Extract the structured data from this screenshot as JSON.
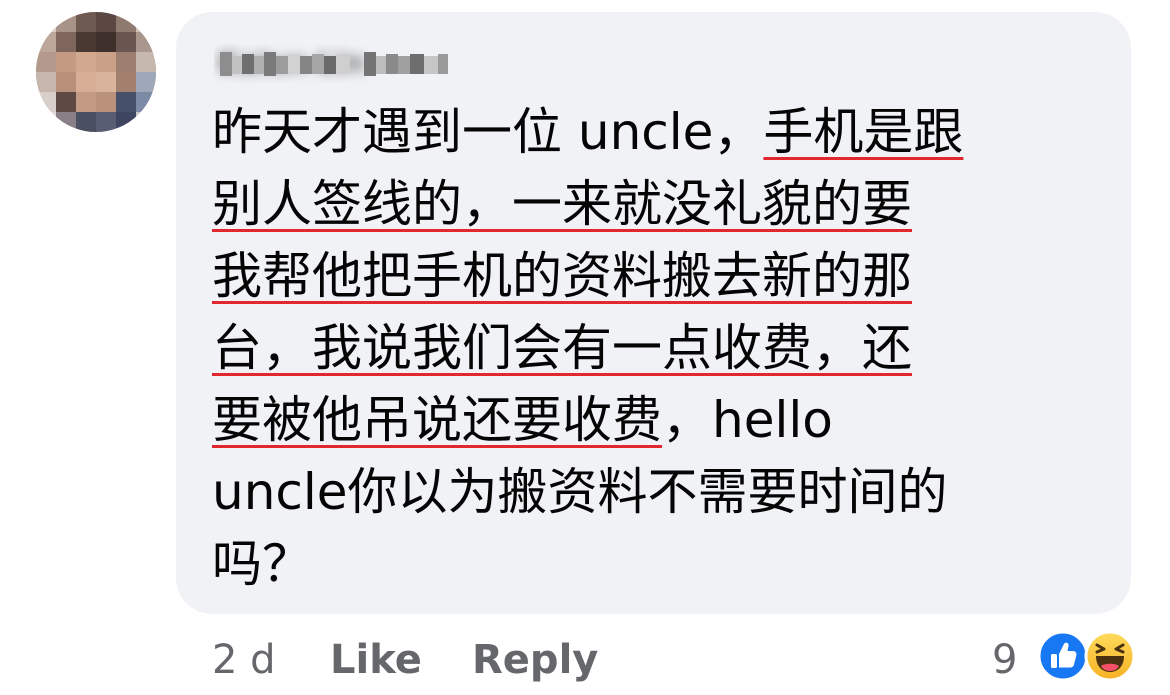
{
  "comment": {
    "author_name": "Kaiun Lin",
    "lines": [
      {
        "plain_before": "昨天才遇到一位 uncle，",
        "underlined": "手机是跟",
        "plain_after": ""
      },
      {
        "plain_before": "",
        "underlined": "别人签线的，一来就没礼貌的要",
        "plain_after": ""
      },
      {
        "plain_before": "",
        "underlined": "我帮他把手机的资料搬去新的那",
        "plain_after": ""
      },
      {
        "plain_before": "",
        "underlined": "台，我说我们会有一点收费，还",
        "plain_after": ""
      },
      {
        "plain_before": "",
        "underlined": "要被他吊说还要收费",
        "plain_after": "，hello"
      },
      {
        "plain_before": "uncle你以为搬资料不需要时间的",
        "underlined": "",
        "plain_after": ""
      },
      {
        "plain_before": "吗？",
        "underlined": "",
        "plain_after": ""
      }
    ]
  },
  "actions": {
    "time": "2 d",
    "like_label": "Like",
    "reply_label": "Reply"
  },
  "reactions": {
    "count": "9",
    "types": [
      "like-icon",
      "haha-icon"
    ]
  },
  "colors": {
    "bubble_bg": "#f0f2f5",
    "text": "#050505",
    "secondary_text": "#65676b",
    "underline": "#e0282e",
    "like_blue": "#1877f2",
    "haha_yellow": "#f7b125"
  }
}
